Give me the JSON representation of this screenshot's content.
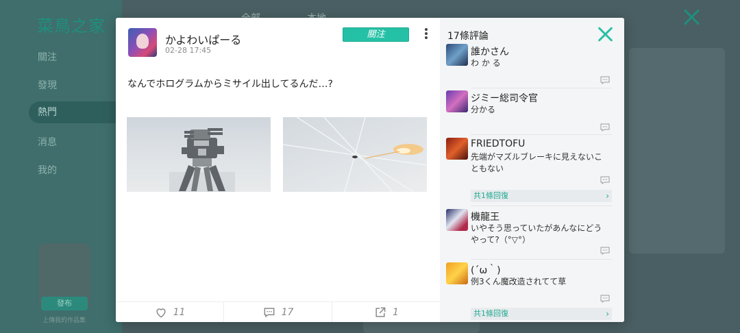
{
  "background": {
    "logo": "菜鳥之家",
    "nav": [
      "關注",
      "發現",
      "熱門",
      "消息",
      "我的"
    ],
    "post_button": "發布",
    "caption": "上傳我的作品集",
    "tabs": [
      "全部",
      "本地"
    ]
  },
  "post": {
    "author": "かよわいぱーる",
    "time": "02-28 17:45",
    "follow_label": "關注",
    "text": "なんでホログラムからミサイル出してるんだ…?",
    "actions": {
      "like_count": "11",
      "comment_count": "17",
      "share_count": "1"
    }
  },
  "comments": {
    "title": "17條評論",
    "items": [
      {
        "name": "誰かさん",
        "text": "わ か る",
        "replies": ""
      },
      {
        "name": "ジミー総司令官",
        "text": "分かる",
        "replies": ""
      },
      {
        "name": "FRIEDTOFU",
        "text": "先端がマズルブレーキに見えないこともない",
        "replies": "共1條回復"
      },
      {
        "name": "機龍王",
        "text": "いやそう思っていたがあんなにどうやって?（°▽°）",
        "replies": ""
      },
      {
        "name": "(´ω｀)",
        "text": "例3くん魔改造されてて草",
        "replies": "共1條回復"
      }
    ]
  },
  "colors": {
    "accent": "#25c1a6",
    "sidebar_bg": "#3f6e6c"
  }
}
